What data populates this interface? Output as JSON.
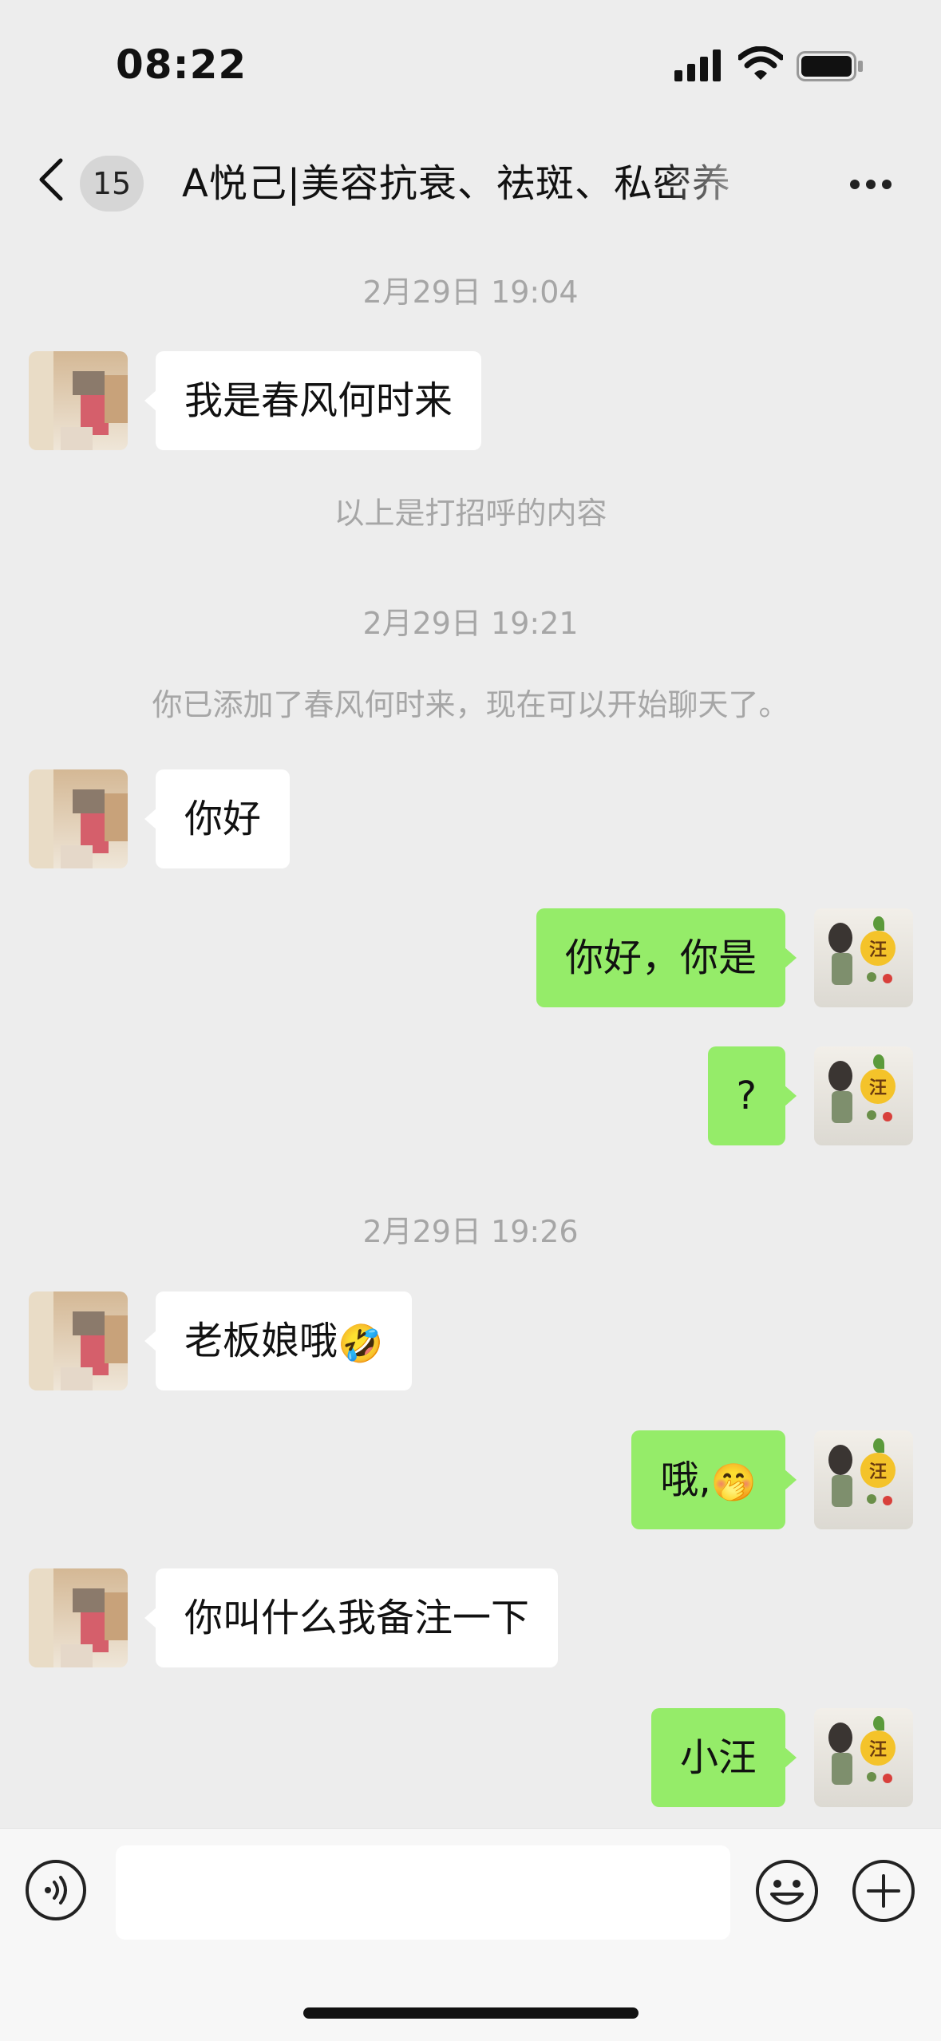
{
  "status_bar": {
    "time": "08:22"
  },
  "nav": {
    "unread_count": "15",
    "title": "A悦己|美容抗衰、祛斑、私密养"
  },
  "messages": [
    {
      "type": "timestamp",
      "text": "2月29日 19:04"
    },
    {
      "type": "incoming",
      "text": "我是春风何时来"
    },
    {
      "type": "system",
      "text": "以上是打招呼的内容"
    },
    {
      "type": "timestamp",
      "text": "2月29日 19:21"
    },
    {
      "type": "system",
      "text": "你已添加了春风何时来，现在可以开始聊天了。"
    },
    {
      "type": "incoming",
      "text": "你好"
    },
    {
      "type": "outgoing",
      "text": "你好，你是"
    },
    {
      "type": "outgoing",
      "text": "?"
    },
    {
      "type": "timestamp",
      "text": "2月29日 19:26"
    },
    {
      "type": "incoming",
      "text": "老板娘哦",
      "emoji": "🤣"
    },
    {
      "type": "outgoing",
      "text": "哦,",
      "emoji": "🤭"
    },
    {
      "type": "incoming",
      "text": "你叫什么我备注一下"
    },
    {
      "type": "outgoing",
      "text": "小汪"
    }
  ],
  "avatar_right_char": "汪",
  "colors": {
    "outgoing_bubble": "#95ec69",
    "incoming_bubble": "#ffffff",
    "background": "#ededed"
  },
  "icons": [
    "signal-icon",
    "wifi-icon",
    "battery-icon",
    "back-chevron-icon",
    "more-icon",
    "voice-icon",
    "emoji-face-icon",
    "plus-icon"
  ]
}
